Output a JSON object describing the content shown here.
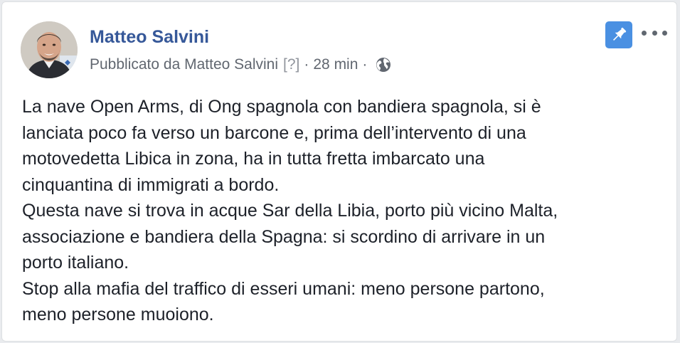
{
  "post": {
    "author_name": "Matteo Salvini",
    "meta": {
      "prefix": "Pubblicato da",
      "author": "Matteo Salvini",
      "help": "[?]",
      "separator": "·",
      "time": "28 min",
      "privacy_icon": "globe-icon"
    },
    "actions": {
      "pin_icon": "pin-icon",
      "more_icon": "ellipsis-icon"
    },
    "body_lines": [
      "La nave Open Arms, di Ong spagnola con bandiera spagnola, si è",
      "lanciata poco fa verso un barcone e, prima dell’intervento di una",
      "motovedetta Libica in zona, ha in tutta fretta imbarcato una",
      "cinquantina di immigrati a bordo.",
      "Questa nave si trova in acque Sar della Libia, porto più vicino Malta,",
      "associazione e bandiera della Spagna: si scordino di arrivare in un",
      "porto italiano.",
      "Stop alla mafia del traffico di esseri umani: meno persone partono,",
      "meno persone muoiono."
    ]
  },
  "colors": {
    "author_link": "#365899",
    "meta_text": "#616770",
    "pin_button": "#4a90e2",
    "body_text": "#1d2129"
  }
}
